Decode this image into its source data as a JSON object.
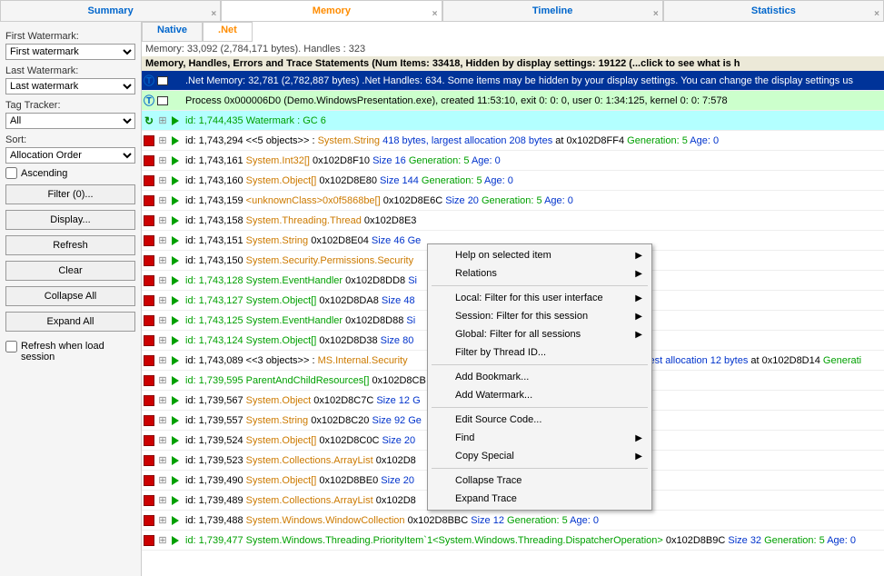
{
  "tabs": {
    "summary": "Summary",
    "memory": "Memory",
    "timeline": "Timeline",
    "statistics": "Statistics"
  },
  "subtabs": {
    "native": "Native",
    "net": ".Net"
  },
  "summaryline": "Memory: 33,092 (2,784,171 bytes). Handles : 323",
  "header": "Memory, Handles, Errors and Trace Statements (Num Items: 33418, Hidden by display settings: 19122      (...click to see what is h",
  "sidebar": {
    "firstWatermark": "First Watermark:",
    "firstWatermarkVal": "First watermark",
    "lastWatermark": "Last Watermark:",
    "lastWatermarkVal": "Last watermark",
    "tagTracker": "Tag Tracker:",
    "tagTrackerVal": "All",
    "sort": "Sort:",
    "sortVal": "Allocation Order",
    "ascending": "Ascending",
    "filterBtn": "Filter (0)...",
    "displayBtn": "Display...",
    "refreshBtn": "Refresh",
    "clearBtn": "Clear",
    "collapseAllBtn": "Collapse All",
    "expandAllBtn": "Expand All",
    "refreshWhen": "Refresh when load session"
  },
  "rows": [
    {
      "kind": "info",
      "icon": "T",
      "mid": "sq",
      "parts": [
        {
          "c": "w",
          "t": ".Net Memory: 32,781 (2,782,887 bytes) .Net Handles: 634. Some items may be hidden by your display settings. You can change the display settings us"
        }
      ]
    },
    {
      "kind": "proc",
      "icon": "T",
      "mid": "sq",
      "parts": [
        {
          "c": "b",
          "t": "Process 0x000006D0 (Demo.WindowsPresentation.exe), created 11:53:10, exit  0: 0: 0, user  0: 1:34:125, kernel  0: 0: 7:578"
        }
      ]
    },
    {
      "kind": "wm",
      "icon": "G",
      "arrow": 1,
      "parts": [
        {
          "c": "g",
          "t": "id: 1,744,435 Watermark : GC 6"
        }
      ]
    },
    {
      "kind": "n",
      "icon": "R",
      "arrow": 1,
      "parts": [
        {
          "c": "b",
          "t": "id: 1,743,294 <<5 objects>> : "
        },
        {
          "c": "o",
          "t": "System.String "
        },
        {
          "c": "s",
          "t": "418 bytes, largest allocation 208 bytes "
        },
        {
          "c": "at",
          "t": "at 0x102D8FF4 "
        },
        {
          "c": "g",
          "t": "Generation: 5 "
        },
        {
          "c": "a",
          "t": "Age: 0"
        }
      ]
    },
    {
      "kind": "n",
      "icon": "R",
      "arrow": 1,
      "parts": [
        {
          "c": "b",
          "t": "id: 1,743,161 "
        },
        {
          "c": "o",
          "t": "System.Int32[] "
        },
        {
          "c": "b",
          "t": "0x102D8F10 "
        },
        {
          "c": "s",
          "t": "Size 16 "
        },
        {
          "c": "g",
          "t": "Generation: 5 "
        },
        {
          "c": "a",
          "t": "Age: 0"
        }
      ]
    },
    {
      "kind": "n",
      "icon": "R",
      "arrow": 1,
      "parts": [
        {
          "c": "b",
          "t": "id: 1,743,160 "
        },
        {
          "c": "o",
          "t": "System.Object[] "
        },
        {
          "c": "b",
          "t": "0x102D8E80 "
        },
        {
          "c": "s",
          "t": "Size 144 "
        },
        {
          "c": "g",
          "t": "Generation: 5 "
        },
        {
          "c": "a",
          "t": "Age: 0"
        }
      ]
    },
    {
      "kind": "n",
      "icon": "R",
      "arrow": 1,
      "parts": [
        {
          "c": "b",
          "t": "id: 1,743,159 "
        },
        {
          "c": "o",
          "t": "<unknownClass>0x0f5868be[] "
        },
        {
          "c": "b",
          "t": "0x102D8E6C "
        },
        {
          "c": "s",
          "t": "Size 20 "
        },
        {
          "c": "g",
          "t": "Generation: 5 "
        },
        {
          "c": "a",
          "t": "Age: 0"
        }
      ]
    },
    {
      "kind": "n",
      "icon": "R",
      "arrow": 1,
      "parts": [
        {
          "c": "b",
          "t": "id: 1,743,158 "
        },
        {
          "c": "o",
          "t": "System.Threading.Thread "
        },
        {
          "c": "b",
          "t": "0x102D8E3"
        }
      ]
    },
    {
      "kind": "n",
      "icon": "R",
      "arrow": 1,
      "parts": [
        {
          "c": "b",
          "t": "id: 1,743,151 "
        },
        {
          "c": "o",
          "t": "System.String "
        },
        {
          "c": "b",
          "t": "0x102D8E04 "
        },
        {
          "c": "s",
          "t": "Size 46 Ge"
        }
      ]
    },
    {
      "kind": "n",
      "icon": "R",
      "arrow": 1,
      "parts": [
        {
          "c": "b",
          "t": "id: 1,743,150 "
        },
        {
          "c": "o",
          "t": "System.Security.Permissions.Security"
        }
      ]
    },
    {
      "kind": "n",
      "icon": "R",
      "arrow": 1,
      "parts": [
        {
          "c": "g",
          "t": "id: 1,743,128 "
        },
        {
          "c": "g",
          "t": "System.EventHandler "
        },
        {
          "c": "b",
          "t": "0x102D8DD8 "
        },
        {
          "c": "s",
          "t": "Si"
        }
      ]
    },
    {
      "kind": "n",
      "icon": "R",
      "arrow": 1,
      "parts": [
        {
          "c": "g",
          "t": "id: 1,743,127 "
        },
        {
          "c": "g",
          "t": "System.Object[] "
        },
        {
          "c": "b",
          "t": "0x102D8DA8 "
        },
        {
          "c": "s",
          "t": "Size 48"
        }
      ]
    },
    {
      "kind": "n",
      "icon": "R",
      "arrow": 1,
      "parts": [
        {
          "c": "g",
          "t": "id: 1,743,125 "
        },
        {
          "c": "g",
          "t": "System.EventHandler "
        },
        {
          "c": "b",
          "t": "0x102D8D88 "
        },
        {
          "c": "s",
          "t": "Si"
        }
      ]
    },
    {
      "kind": "n",
      "icon": "R",
      "arrow": 1,
      "parts": [
        {
          "c": "g",
          "t": "id: 1,743,124 "
        },
        {
          "c": "g",
          "t": "System.Object[] "
        },
        {
          "c": "b",
          "t": "0x102D8D38 "
        },
        {
          "c": "s",
          "t": "Size 80"
        }
      ]
    },
    {
      "kind": "n",
      "icon": "R",
      "arrow": 1,
      "parts": [
        {
          "c": "b",
          "t": "id: 1,743,089 <<3 objects>> : "
        },
        {
          "c": "o",
          "t": "MS.Internal.Security"
        },
        {
          "c": "end",
          "t": "argest allocation 12 bytes "
        },
        {
          "c": "at",
          "t": "at 0x102D8D14 "
        },
        {
          "c": "g",
          "t": "Generati"
        }
      ]
    },
    {
      "kind": "n",
      "icon": "R",
      "arrow": 1,
      "parts": [
        {
          "c": "g",
          "t": "id: 1,739,595 "
        },
        {
          "c": "g",
          "t": "ParentAndChildResources[] "
        },
        {
          "c": "b",
          "t": "0x102D8CB"
        }
      ]
    },
    {
      "kind": "n",
      "icon": "R",
      "arrow": 1,
      "parts": [
        {
          "c": "b",
          "t": "id: 1,739,567 "
        },
        {
          "c": "o",
          "t": "System.Object "
        },
        {
          "c": "b",
          "t": "0x102D8C7C "
        },
        {
          "c": "s",
          "t": "Size 12 G"
        }
      ]
    },
    {
      "kind": "n",
      "icon": "R",
      "arrow": 1,
      "parts": [
        {
          "c": "b",
          "t": "id: 1,739,557 "
        },
        {
          "c": "o",
          "t": "System.String "
        },
        {
          "c": "b",
          "t": "0x102D8C20 "
        },
        {
          "c": "s",
          "t": "Size 92 Ge"
        }
      ]
    },
    {
      "kind": "n",
      "icon": "R",
      "arrow": 1,
      "parts": [
        {
          "c": "b",
          "t": "id: 1,739,524 "
        },
        {
          "c": "o",
          "t": "System.Object[] "
        },
        {
          "c": "b",
          "t": "0x102D8C0C "
        },
        {
          "c": "s",
          "t": "Size 20"
        }
      ]
    },
    {
      "kind": "n",
      "icon": "R",
      "arrow": 1,
      "parts": [
        {
          "c": "b",
          "t": "id: 1,739,523 "
        },
        {
          "c": "o",
          "t": "System.Collections.ArrayList "
        },
        {
          "c": "b",
          "t": "0x102D8"
        }
      ]
    },
    {
      "kind": "n",
      "icon": "R",
      "arrow": 1,
      "parts": [
        {
          "c": "b",
          "t": "id: 1,739,490 "
        },
        {
          "c": "o",
          "t": "System.Object[] "
        },
        {
          "c": "b",
          "t": "0x102D8BE0 "
        },
        {
          "c": "s",
          "t": "Size 20"
        }
      ]
    },
    {
      "kind": "n",
      "icon": "R",
      "arrow": 1,
      "parts": [
        {
          "c": "b",
          "t": "id: 1,739,489 "
        },
        {
          "c": "o",
          "t": "System.Collections.ArrayList "
        },
        {
          "c": "b",
          "t": "0x102D8"
        }
      ]
    },
    {
      "kind": "n",
      "icon": "R",
      "arrow": 1,
      "parts": [
        {
          "c": "b",
          "t": "id: 1,739,488 "
        },
        {
          "c": "o",
          "t": "System.Windows.WindowCollection "
        },
        {
          "c": "b",
          "t": "0x102D8BBC "
        },
        {
          "c": "s",
          "t": "Size 12 "
        },
        {
          "c": "g",
          "t": "Generation: 5 "
        },
        {
          "c": "a",
          "t": "Age: 0"
        }
      ]
    },
    {
      "kind": "n",
      "icon": "R",
      "arrow": 1,
      "parts": [
        {
          "c": "g",
          "t": "id: 1,739,477 "
        },
        {
          "c": "g",
          "t": "System.Windows.Threading.PriorityItem`1<System.Windows.Threading.DispatcherOperation> "
        },
        {
          "c": "b",
          "t": "0x102D8B9C "
        },
        {
          "c": "s",
          "t": "Size 32 "
        },
        {
          "c": "g",
          "t": "Generation: 5 "
        },
        {
          "c": "a",
          "t": "Age: 0"
        }
      ]
    }
  ],
  "ctx": {
    "helpSelected": "Help on selected item",
    "relations": "Relations",
    "localFilter": "Local: Filter for this user interface",
    "sessionFilter": "Session: Filter for this session",
    "globalFilter": "Global: Filter for all sessions",
    "filterThread": "Filter by Thread ID...",
    "addBookmark": "Add Bookmark...",
    "addWatermark": "Add Watermark...",
    "editSource": "Edit Source Code...",
    "find": "Find",
    "copySpecial": "Copy Special",
    "collapseTrace": "Collapse Trace",
    "expandTrace": "Expand Trace"
  }
}
